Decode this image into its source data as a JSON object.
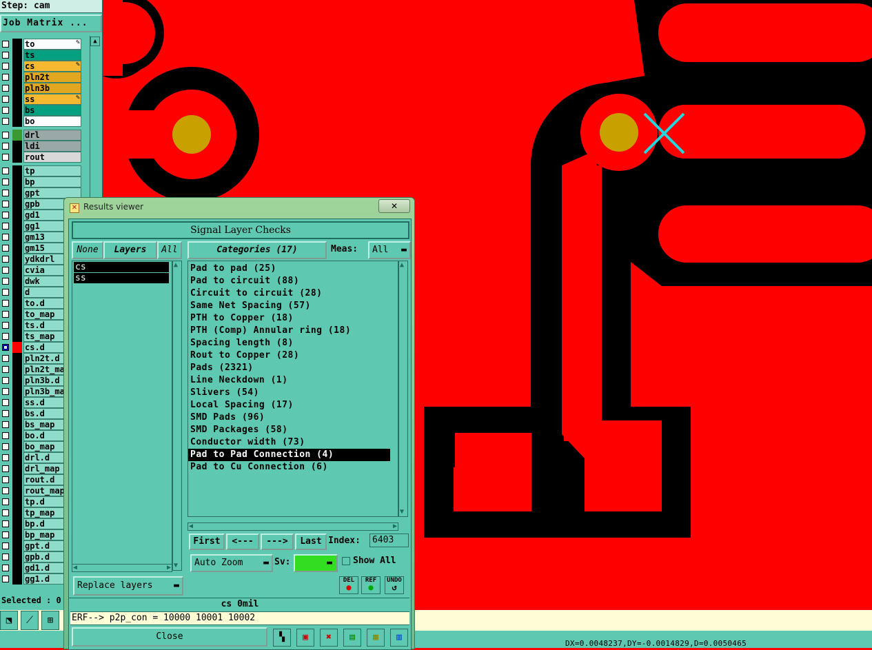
{
  "step_label": "Step: cam",
  "job_matrix_label": "Job Matrix ...",
  "layers": [
    {
      "name": "to",
      "color": "#ffffff",
      "pen": "✎"
    },
    {
      "name": "ts",
      "color": "#00a080",
      "pen": ""
    },
    {
      "name": "cs",
      "color": "#f5b830",
      "pen": "✎"
    },
    {
      "name": "pln2t",
      "color": "#e0a820",
      "pen": ""
    },
    {
      "name": "pln3b",
      "color": "#e0a820",
      "pen": ""
    },
    {
      "name": "ss",
      "color": "#f5b830",
      "pen": "✎"
    },
    {
      "name": "bs",
      "color": "#00a080",
      "pen": ""
    },
    {
      "name": "bo",
      "color": "#ffffff",
      "pen": ""
    }
  ],
  "drill_layers": [
    {
      "name": "drl",
      "color": "#9aa8a8"
    },
    {
      "name": "ldi",
      "color": "#9aa8a8"
    },
    {
      "name": "rout",
      "color": "#d8d8d8"
    }
  ],
  "misc_layers": [
    "tp",
    "bp",
    "gpt",
    "gpb",
    "gd1",
    "gg1",
    "gm13",
    "gm15",
    "ydkdrl",
    "cvia",
    "dwk",
    "d",
    "to.d",
    "to_map",
    "ts.d",
    "ts_map",
    "cs.d",
    "pln2t.d",
    "pln2t_ma",
    "pln3b.d",
    "pln3b_ma",
    "ss.d",
    "bs.d",
    "bs_map",
    "bo.d",
    "bo_map",
    "drl.d",
    "drl_map",
    "rout.d",
    "rout_map",
    "tp.d",
    "tp_map",
    "bp.d",
    "bp_map",
    "gpt.d",
    "gpb.d",
    "gd1.d",
    "gg1.d"
  ],
  "selected_label": "Selected : 0",
  "window": {
    "title": "Results viewer",
    "close_glyph": "✕",
    "header": "Signal Layer Checks",
    "none_btn": "None",
    "layers_btn": "Layers",
    "all_btn": "All",
    "selected_layers": [
      "cs",
      "ss"
    ],
    "categories_btn": "Categories (17)",
    "meas_label": "Meas:",
    "meas_value": "All",
    "categories": [
      "Pad to pad (25)",
      "Pad to circuit (88)",
      "Circuit to circuit (28)",
      "Same Net Spacing (57)",
      "PTH to Copper (18)",
      "PTH (Comp) Annular ring (18)",
      "Spacing length (8)",
      "Rout to Copper (28)",
      "Pads (2321)",
      "Line Neckdown (1)",
      "Slivers (54)",
      "Local Spacing (17)",
      "SMD Pads (96)",
      "SMD Packages (58)",
      "Conductor width (73)",
      "Pad to Pad Connection (4)",
      "Pad to Cu Connection (6)"
    ],
    "selected_category": "Pad to Pad Connection (4)",
    "first_btn": "First",
    "prev_btn": "<---",
    "next_btn": "--->",
    "last_btn": "Last",
    "index_label": "Index:",
    "index_value": "6403",
    "auto_zoom": "Auto Zoom",
    "sv_label": "Sv:",
    "sv_color": "#33dd22",
    "show_all": "Show All",
    "replace_layers": "Replace layers",
    "del_btn": "DEL",
    "ref_btn": "REF",
    "undo_btn": "UNDO",
    "status_text": "cs 0mil",
    "erf_text": "ERF--> p2p_con = 10000 10001 10002",
    "close_btn": "Close"
  },
  "coords": "DX=0.0048237,DY=-0.0014829,D=0.0050465",
  "colors": {
    "copper": "#ff0000",
    "clearance": "#000000",
    "pad_hole": "#c8a000",
    "marker": "#22d8e0",
    "panel": "#5fc8b0"
  }
}
